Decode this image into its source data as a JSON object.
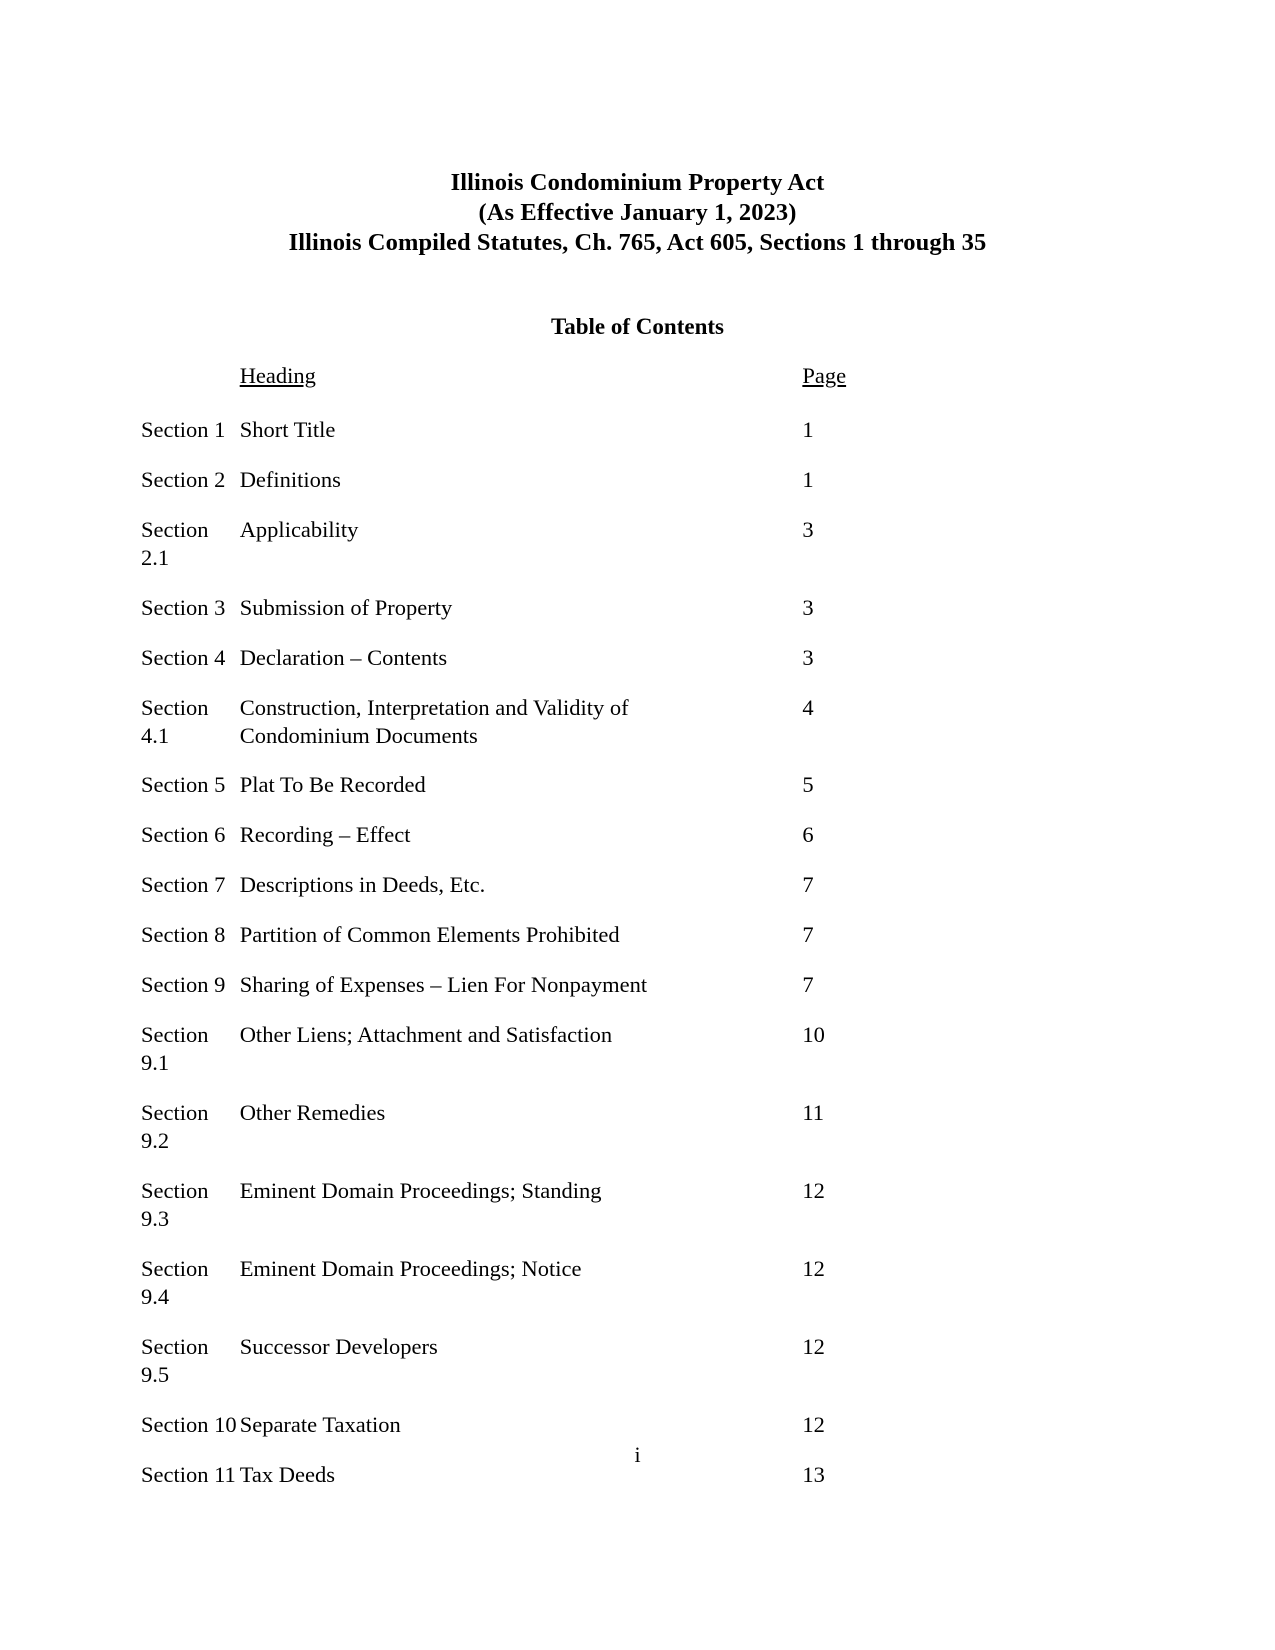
{
  "document": {
    "title_lines": [
      "Illinois Condominium Property Act",
      "(As Effective January 1, 2023)",
      "Illinois Compiled Statutes, Ch. 765, Act 605, Sections 1 through 35"
    ],
    "toc_title": "Table of Contents",
    "footer_page_number": "i"
  },
  "toc": {
    "columns": {
      "section": "",
      "heading": "Heading",
      "page": "Page"
    },
    "rows": [
      {
        "section": "Section 1",
        "heading": "Short Title",
        "heading_line2": "",
        "page": "1"
      },
      {
        "section": "Section 2",
        "heading": "Definitions",
        "heading_line2": "",
        "page": "1"
      },
      {
        "section": "Section 2.1",
        "heading": "Applicability",
        "heading_line2": "",
        "page": "3"
      },
      {
        "section": "Section 3",
        "heading": "Submission of Property",
        "heading_line2": "",
        "page": "3"
      },
      {
        "section": "Section 4",
        "heading": "Declaration – Contents",
        "heading_line2": "",
        "page": "3"
      },
      {
        "section": "Section 4.1",
        "heading": "Construction, Interpretation and Validity of",
        "heading_line2": "Condominium Documents",
        "page": "4"
      },
      {
        "section": "Section 5",
        "heading": "Plat To Be Recorded",
        "heading_line2": "",
        "page": "5"
      },
      {
        "section": "Section 6",
        "heading": "Recording – Effect",
        "heading_line2": "",
        "page": "6"
      },
      {
        "section": "Section 7",
        "heading": "Descriptions in Deeds, Etc.",
        "heading_line2": "",
        "page": "7"
      },
      {
        "section": "Section 8",
        "heading": "Partition of Common Elements Prohibited",
        "heading_line2": "",
        "page": "7"
      },
      {
        "section": "Section 9",
        "heading": "Sharing of Expenses – Lien For Nonpayment",
        "heading_line2": "",
        "page": "7"
      },
      {
        "section": "Section 9.1",
        "heading": "Other Liens; Attachment and Satisfaction",
        "heading_line2": "",
        "page": "10"
      },
      {
        "section": "Section 9.2",
        "heading": "Other Remedies",
        "heading_line2": "",
        "page": "11"
      },
      {
        "section": "Section 9.3",
        "heading": "Eminent Domain Proceedings; Standing",
        "heading_line2": "",
        "page": "12"
      },
      {
        "section": "Section 9.4",
        "heading": "Eminent Domain Proceedings; Notice",
        "heading_line2": "",
        "page": "12"
      },
      {
        "section": "Section 9.5",
        "heading": "Successor Developers",
        "heading_line2": "",
        "page": "12"
      },
      {
        "section": "Section 10",
        "heading": "Separate Taxation",
        "heading_line2": "",
        "page": "12"
      },
      {
        "section": "Section 11",
        "heading": "Tax Deeds",
        "heading_line2": "",
        "page": "13"
      }
    ]
  }
}
